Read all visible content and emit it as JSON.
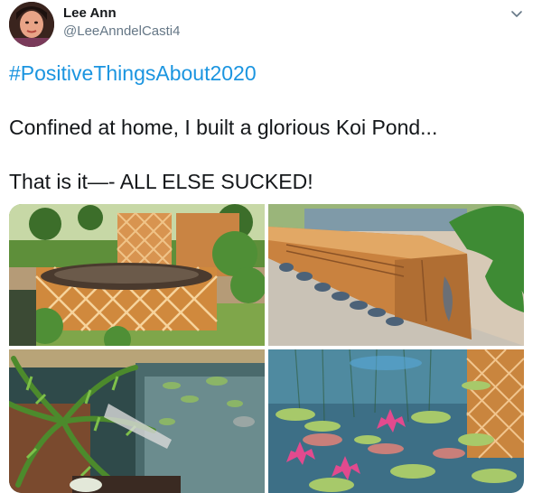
{
  "tweet": {
    "author": {
      "name": "Lee Ann",
      "handle": "@LeeAnndelCasti4",
      "avatar_icon": "avatar-photo"
    },
    "menu_icon": "chevron-down-icon",
    "hashtag": "#PositiveThingsAbout2020",
    "lines": [
      "Confined at home, I built a glorious Koi Pond...",
      "That is it—- ALL ELSE SUCKED!"
    ],
    "media": [
      {
        "name": "koi-pond-lattice-fence-photo"
      },
      {
        "name": "wooden-pond-edge-photo"
      },
      {
        "name": "palm-pond-photo"
      },
      {
        "name": "water-lilies-photo"
      }
    ]
  },
  "colors": {
    "link": "#1b95e0",
    "text": "#14171a",
    "secondary": "#657786"
  }
}
